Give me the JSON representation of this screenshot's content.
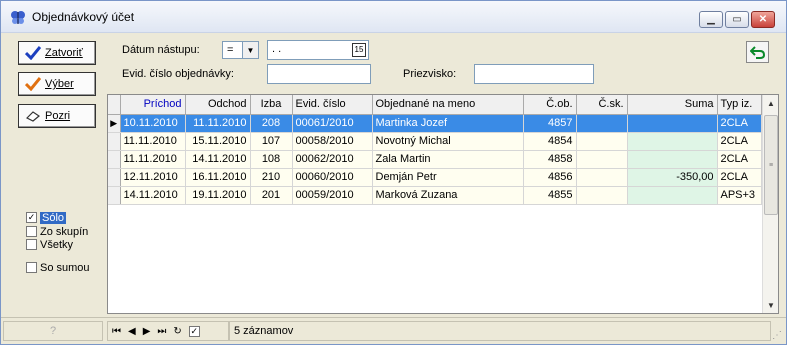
{
  "window": {
    "title": "Objednávkový účet"
  },
  "left_buttons": [
    {
      "label": "Zatvoriť",
      "icon": "checkmark-blue-icon"
    },
    {
      "label": "Výber",
      "icon": "checkmark-orange-icon"
    },
    {
      "label": "Pozri",
      "icon": "eraser-icon"
    }
  ],
  "filter_options": {
    "solo": {
      "label": "Sólo",
      "checked": true
    },
    "zo_skupin": {
      "label": "Zo skupín",
      "checked": false
    },
    "vsetky": {
      "label": "Všetky",
      "checked": false
    },
    "so_sumou": {
      "label": "So sumou",
      "checked": false
    }
  },
  "form": {
    "datum_label": "Dátum nástupu:",
    "operator_value": "=",
    "date_value": " .  .",
    "evid_label": "Evid. číslo objednávky:",
    "evid_value": "",
    "priezvisko_label": "Priezvisko:",
    "priezvisko_value": ""
  },
  "table": {
    "columns": [
      "Príchod",
      "Odchod",
      "Izba",
      "Evid. číslo",
      "Objednané na meno",
      "Č.ob.",
      "Č.sk.",
      "Suma",
      "Typ iz."
    ],
    "rows": [
      [
        "10.11.2010",
        "11.11.2010",
        "208",
        "00061/2010",
        "Martinka Jozef",
        "4857",
        "",
        "",
        "2CLA"
      ],
      [
        "11.11.2010",
        "15.11.2010",
        "107",
        "00058/2010",
        "Novotný Michal",
        "4854",
        "",
        "",
        "2CLA"
      ],
      [
        "11.11.2010",
        "14.11.2010",
        "108",
        "00062/2010",
        "Zala Martin",
        "4858",
        "",
        "",
        "2CLA"
      ],
      [
        "12.11.2010",
        "16.11.2010",
        "210",
        "00060/2010",
        "Demján Petr",
        "4856",
        "",
        "-350,00",
        "2CLA"
      ],
      [
        "14.11.2010",
        "19.11.2010",
        "201",
        "00059/2010",
        "Marková Zuzana",
        "4855",
        "",
        "",
        "APS+3"
      ]
    ],
    "selected_row": 0
  },
  "status": {
    "help_glyph": "?",
    "record_count": "5 záznamov"
  },
  "colors": {
    "selection": "#3a8be6",
    "sorted_header": "#0000c0",
    "row_bg": "#fffef0",
    "sum_bg": "#dff5e6"
  }
}
